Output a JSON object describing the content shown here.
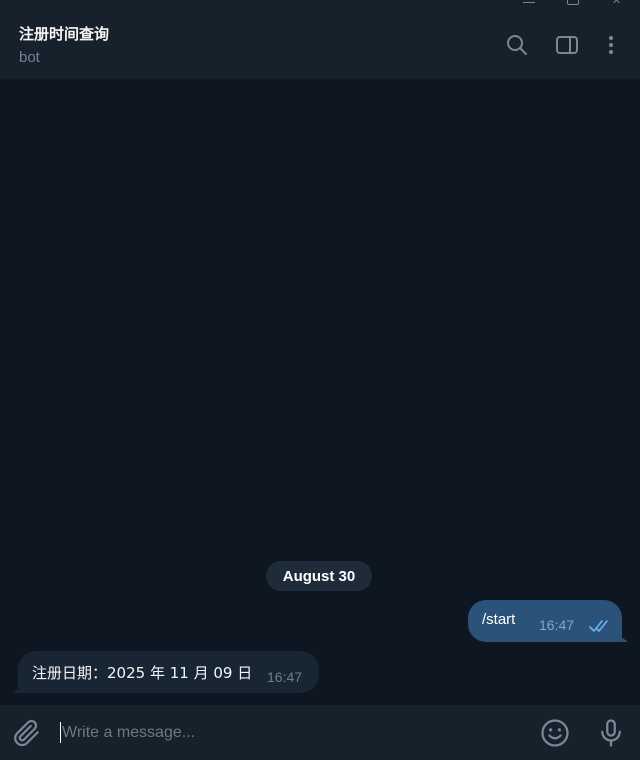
{
  "window": {
    "controls": [
      "minimize-icon",
      "maximize-icon",
      "close-icon"
    ]
  },
  "header": {
    "title": "注册时间查询",
    "status": "bot",
    "actions": [
      "search-icon",
      "sidebar-toggle-icon",
      "more-vertical-icon"
    ]
  },
  "chat": {
    "date_separator": "August 30",
    "messages": [
      {
        "direction": "outgoing",
        "text": "/start",
        "time": "16:47",
        "status": "read",
        "status_icon": "double-check-icon"
      },
      {
        "direction": "incoming",
        "text": "注册日期：2025 年 11 月 09 日",
        "time": "16:47"
      }
    ]
  },
  "composer": {
    "placeholder": "Write a message...",
    "value": "",
    "icons": [
      "paperclip-icon",
      "emoji-icon",
      "microphone-icon"
    ]
  },
  "colors": {
    "background": "#0e1621",
    "header": "#17212b",
    "outgoing_bubble": "#2b5278",
    "incoming_bubble": "#182533",
    "date_pill": "#1e2c3a",
    "read_check": "#64b5f6",
    "icon": "#7b8795"
  }
}
